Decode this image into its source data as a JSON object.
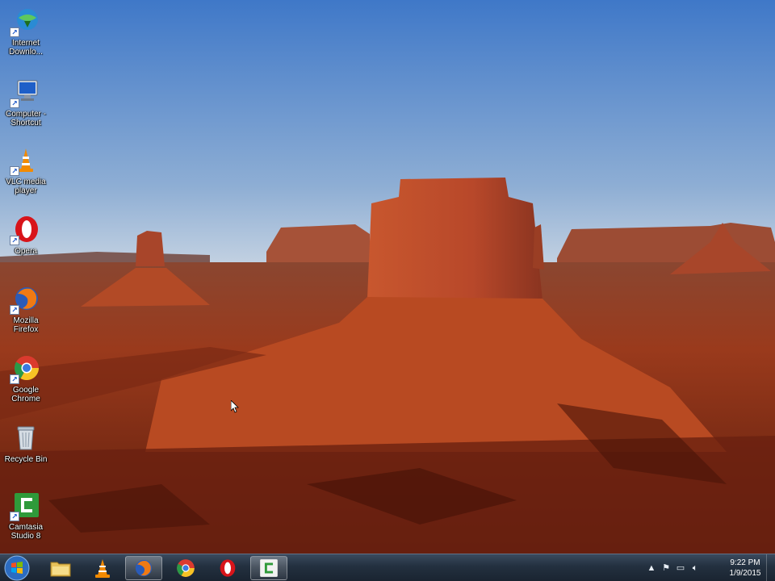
{
  "desktop": {
    "icons": [
      {
        "label": "Internet Downlo...",
        "icon": "internet-download-manager-icon"
      },
      {
        "label": "Computer - Shortcut",
        "icon": "computer-icon"
      },
      {
        "label": "VLC media player",
        "icon": "vlc-icon"
      },
      {
        "label": "Opera",
        "icon": "opera-icon"
      },
      {
        "label": "Mozilla Firefox",
        "icon": "firefox-icon"
      },
      {
        "label": "Google Chrome",
        "icon": "chrome-icon"
      },
      {
        "label": "Recycle Bin",
        "icon": "recycle-bin-icon"
      },
      {
        "label": "Camtasia Studio 8",
        "icon": "camtasia-icon"
      }
    ]
  },
  "taskbar": {
    "pinned": [
      {
        "icon": "windows-explorer-icon"
      },
      {
        "icon": "vlc-icon"
      },
      {
        "icon": "firefox-icon",
        "active": true
      },
      {
        "icon": "chrome-icon"
      },
      {
        "icon": "opera-icon"
      },
      {
        "icon": "camtasia-icon",
        "active": true
      }
    ],
    "tray": {
      "time": "9:22 PM",
      "date": "1/9/2015"
    }
  },
  "colors": {
    "sky_top": "#3f78c8",
    "sky_horizon": "#b8cbe0",
    "rock": "#b6492a",
    "ground": "#7a2a12",
    "taskbar": "#23303f"
  }
}
